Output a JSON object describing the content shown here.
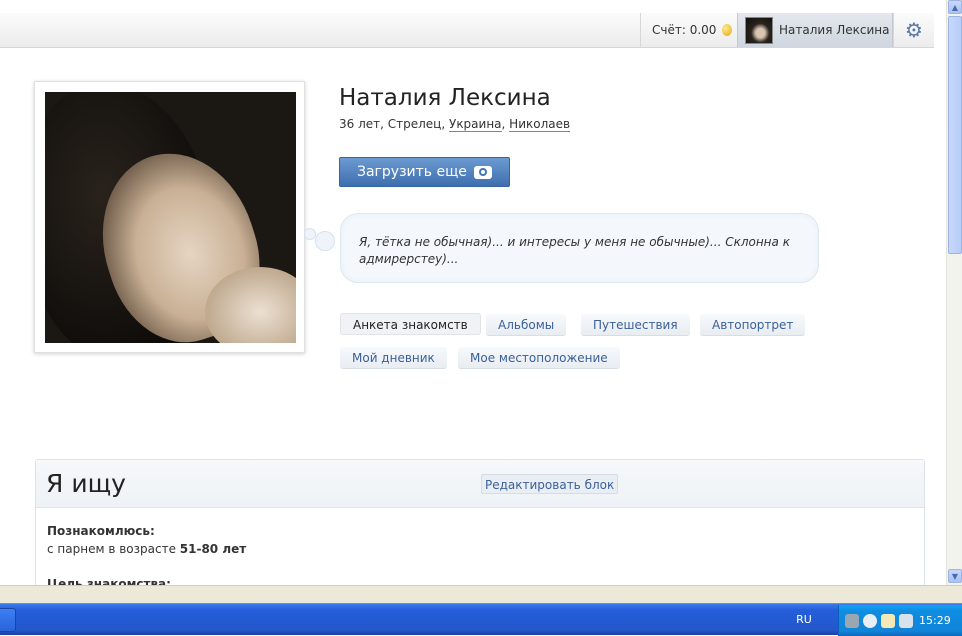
{
  "header": {
    "account_label": "Счёт: 0.00",
    "user_name": "Наталия Лексина"
  },
  "profile": {
    "name": "Наталия Лексина",
    "meta_prefix": "36 лет, Стрелец,",
    "country": "Украина",
    "city": "Николаев",
    "upload_label": "Загрузить еще",
    "status_text": "Я, тётка не обычная)... и интересы у меня не обычные)... Склонна к адмирерстеу)...",
    "tabs": [
      {
        "label": "Анкета знакомств",
        "active": true
      },
      {
        "label": "Альбомы"
      },
      {
        "label": "Путешествия"
      },
      {
        "label": "Автопортрет"
      },
      {
        "label": "Мой дневник"
      },
      {
        "label": "Мое местоположение"
      }
    ]
  },
  "looking_for": {
    "title": "Я ищу",
    "edit_label": "Редактировать блок",
    "meet_label": "Познакомлюсь:",
    "meet_prefix": "с парнем в возрасте",
    "meet_age": "51-80 лет",
    "goal_label": "Цель знакомства:"
  },
  "taskbar": {
    "language": "RU",
    "clock": "15:29"
  },
  "colors": {
    "accent_blue": "#3e6fae",
    "link_blue": "#3b5f99",
    "taskbar_blue": "#245edb"
  }
}
